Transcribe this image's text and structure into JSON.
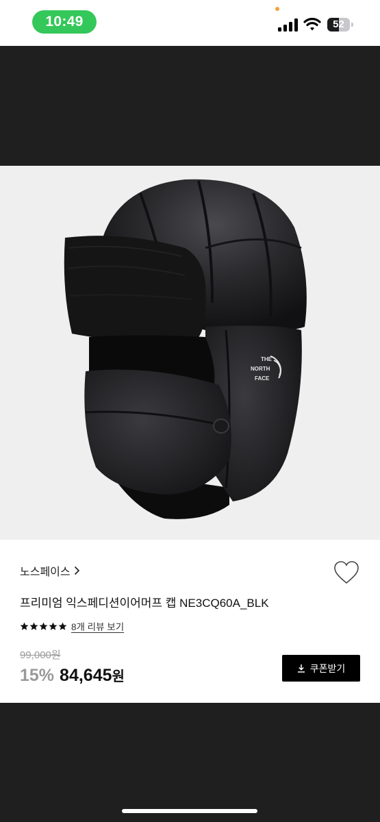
{
  "status_bar": {
    "time": "10:49",
    "battery_level": "52",
    "battery_fill_percent": 52,
    "icons": [
      "signal-icon",
      "wifi-icon",
      "battery-icon"
    ],
    "pill_color": "#34c759"
  },
  "product": {
    "image_icon": "trapper-hat-image",
    "image_logo_text": [
      "THE",
      "NORTH",
      "FACE"
    ],
    "brand": "노스페이스",
    "title": "프리미엄 익스페디션이어머프 캡 NE3CQ60A_BLK",
    "rating_stars": 5,
    "review_link": "8개 리뷰 보기",
    "original_price": "99,000원",
    "discount_rate": "15%",
    "sale_price": "84,645",
    "price_unit": "원",
    "coupon_button": "쿠폰받기"
  },
  "colors": {
    "background_dark": "#1f1f1f",
    "accent_black": "#000000",
    "muted_gray": "#9a9a9a"
  }
}
